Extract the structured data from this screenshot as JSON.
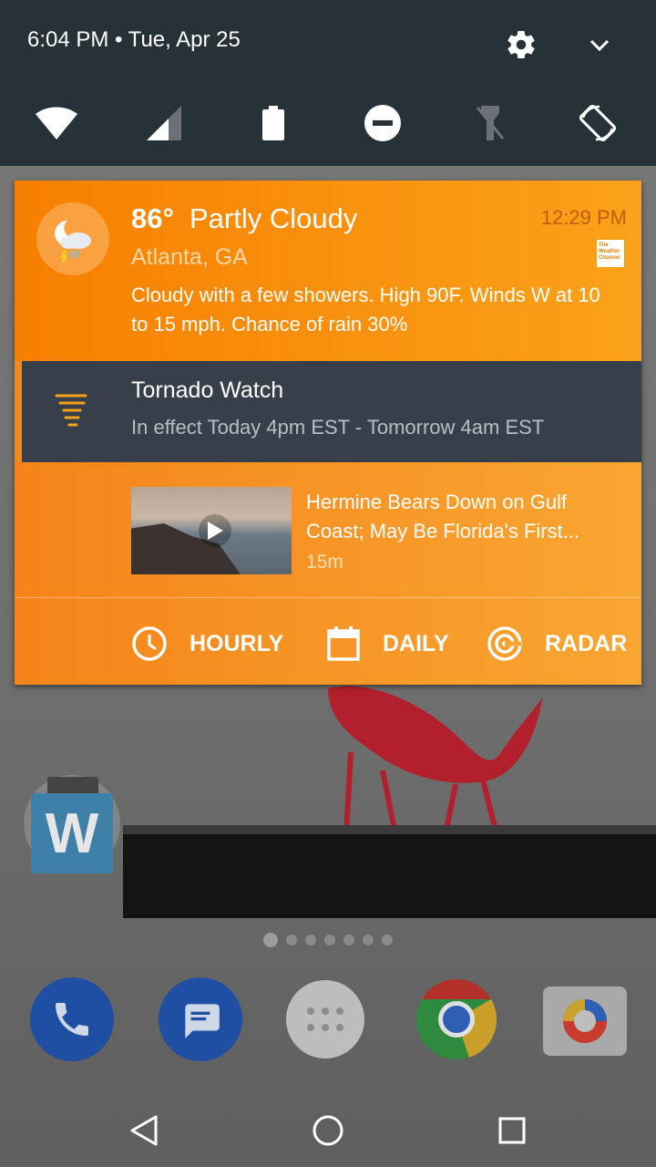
{
  "status_bar": {
    "time_date": "6:04 PM • Tue, Apr 25"
  },
  "quick_settings": {
    "tiles": [
      "wifi-icon",
      "cellular-signal-icon",
      "battery-icon",
      "do-not-disturb-icon",
      "flashlight-off-icon",
      "auto-rotate-icon"
    ]
  },
  "notification": {
    "temperature": "86°",
    "condition": "Partly Cloudy",
    "location": "Atlanta, GA",
    "time": "12:29 PM",
    "brand_logo_text": "The Weather Channel",
    "summary": "Cloudy with a few showers. High 90F. Winds W at 10 to 15 mph. Chance of rain 30%",
    "alert": {
      "title": "Tornado Watch",
      "subtitle": "In effect Today 4pm EST - Tomorrow 4am EST"
    },
    "story": {
      "title": "Hermine Bears Down on Gulf Coast; May Be Florida's First...",
      "age": "15m"
    },
    "actions": {
      "hourly": "HOURLY",
      "daily": "DAILY",
      "radar": "RADAR"
    }
  },
  "home": {
    "widget_letter": "W",
    "page_count": 7,
    "active_page": 0,
    "dock": [
      "phone-icon",
      "messages-icon",
      "app-drawer-icon",
      "chrome-icon",
      "camera-icon"
    ]
  },
  "colors": {
    "accent_orange": "#f28a1e",
    "quick_settings_bg": "#263238",
    "alert_bg": "#37404a"
  }
}
